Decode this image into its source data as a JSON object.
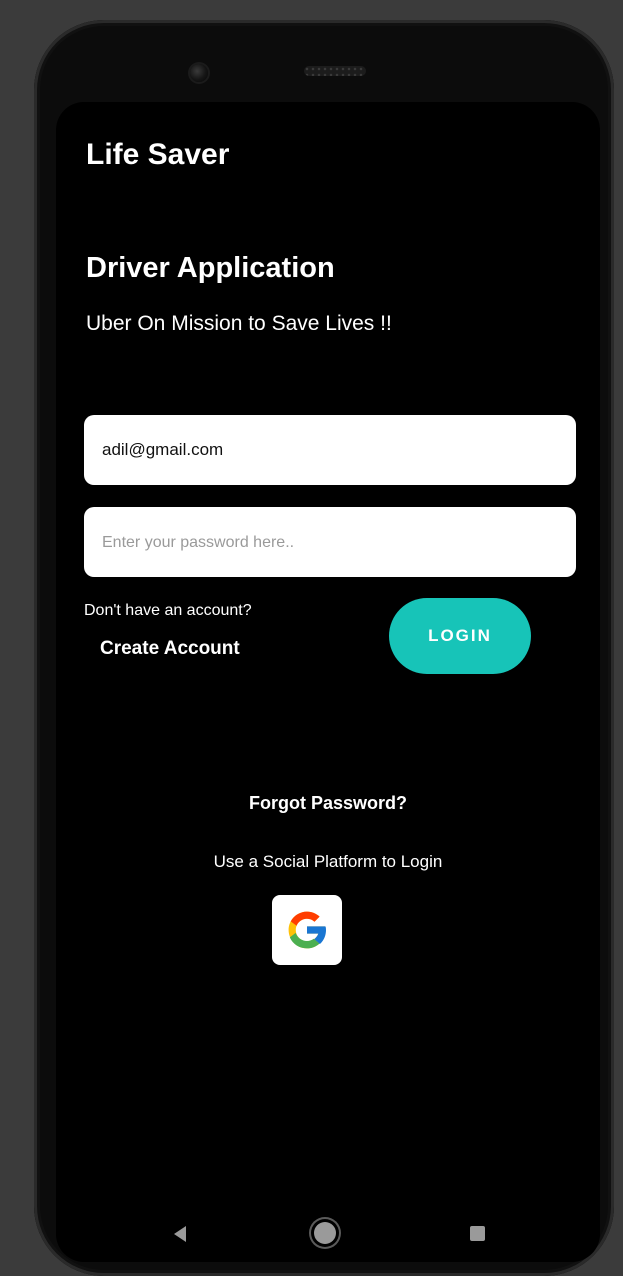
{
  "header": {
    "app_title": "Life Saver"
  },
  "intro": {
    "title": "Driver Application",
    "tagline": "Uber On Mission to Save Lives !!"
  },
  "form": {
    "email_value": "adil@gmail.com",
    "password_placeholder": "Enter your password here.."
  },
  "account": {
    "prompt": "Don't have an account?",
    "create_label": "Create Account"
  },
  "login_label": "LOGIN",
  "forgot_label": "Forgot Password?",
  "social": {
    "label": "Use a Social Platform to Login",
    "provider_icon": "google-icon"
  },
  "colors": {
    "accent": "#17c4b8",
    "background": "#000000"
  },
  "nav": {
    "back_icon": "back-triangle-icon",
    "home_icon": "home-circle-icon",
    "recent_icon": "recent-apps-square-icon"
  }
}
